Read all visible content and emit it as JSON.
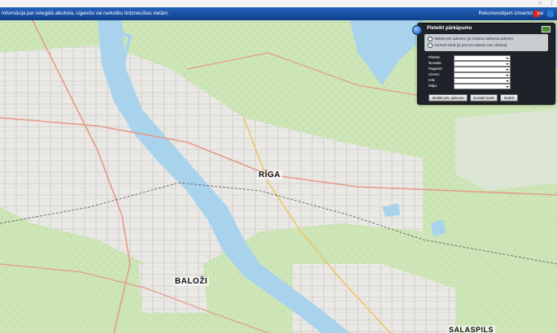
{
  "browser": {
    "star_glyph": "☆",
    "menu_glyph": "⋮"
  },
  "topbar": {
    "message": "Informācija par nelegālā alkohola, cigarešu vai narkotiku tirdzniecības vietām.",
    "recommend_label": "Rekomendējam izmantot",
    "or_label": "vai",
    "icon_colors": {
      "browser_a": "#e0241b",
      "browser_b": "#2a7ad1"
    }
  },
  "map": {
    "labels": {
      "riga": "RĪGA",
      "balozi": "BALOŽI",
      "salaspils": "SALASPILS"
    },
    "colors": {
      "water": "#a9d3ec",
      "forest": "#c9e3b4",
      "urban": "#e8e6e3",
      "road": "#e59a88",
      "major_road": "#f0c05a"
    }
  },
  "panel": {
    "title": "Pieteikt pārkāpumu",
    "options": [
      "Meklēt pēc adreses (ja zināma notikuma adrese)",
      "Atzīmēt kartē (ja precīza adrese nav zināma)"
    ],
    "fields": [
      "Pilsēta:",
      "Novads:",
      "Pagasts:",
      "Ciems:",
      "Iela:",
      "Māja:"
    ],
    "buttons": {
      "search": "Meklēt pēc adreses",
      "mark": "Norādīt kartē",
      "clear": "Notīrīt"
    }
  }
}
